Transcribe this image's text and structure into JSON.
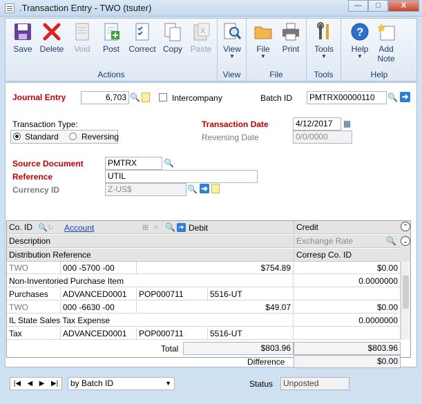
{
  "window": {
    "title": ".Transaction Entry  -  TWO (tsuter)",
    "minimize": "—",
    "restore": "□",
    "close": "X"
  },
  "ribbon": {
    "buttons": {
      "save": "Save",
      "delete": "Delete",
      "void": "Void",
      "post": "Post",
      "correct": "Correct",
      "copy": "Copy",
      "paste": "Paste",
      "view": "View",
      "file": "File",
      "print": "Print",
      "tools": "Tools",
      "help": "Help",
      "add_note_line1": "Add",
      "add_note_line2": "Note"
    },
    "groups": {
      "actions": "Actions",
      "view": "View",
      "file": "File",
      "tools": "Tools",
      "help": "Help"
    }
  },
  "form": {
    "journal_entry_label": "Journal Entry",
    "journal_entry_value": "6,703",
    "intercompany_label": "Intercompany",
    "batch_id_label": "Batch ID",
    "batch_id_value": "PMTRX00000110",
    "transaction_type_label": "Transaction Type:",
    "type_standard": "Standard",
    "type_reversing": "Reversing",
    "transaction_date_label": "Transaction Date",
    "transaction_date_value": "4/12/2017",
    "reversing_date_label": "Reversing Date",
    "reversing_date_value": "0/0/0000",
    "source_document_label": "Source Document",
    "source_document_value": "PMTRX",
    "reference_label": "Reference",
    "reference_value": "UTIL",
    "currency_id_label": "Currency ID",
    "currency_id_value": "Z-US$"
  },
  "grid": {
    "headers": {
      "co_id": "Co. ID",
      "account": "Account",
      "debit": "Debit",
      "credit": "Credit",
      "description": "Description",
      "exchange_rate": "Exchange Rate",
      "distribution_reference": "Distribution Reference",
      "corresp_co_id": "Corresp Co. ID"
    },
    "rows": [
      {
        "co_id": "TWO",
        "account": "000 -5700 -00",
        "debit": "$754.89",
        "credit": "$0.00",
        "description": "Non-Inventoried Purchase Item",
        "exchange_rate": "0.0000000",
        "dist_ref": "Purchases",
        "vendor": "ADVANCED0001",
        "doc": "POP000711",
        "code": "5516-UT"
      },
      {
        "co_id": "TWO",
        "account": "000 -6630 -00",
        "debit": "$49.07",
        "credit": "$0.00",
        "description": "IL State Sales Tax Expense",
        "exchange_rate": "0.0000000",
        "dist_ref": "Tax",
        "vendor": "ADVANCED0001",
        "doc": "POP000711",
        "code": "5516-UT"
      }
    ]
  },
  "totals": {
    "total_label": "Total",
    "total_debit": "$803.96",
    "total_credit": "$803.96",
    "difference_label": "Difference",
    "difference_value": "$0.00"
  },
  "footer": {
    "browse_by": "by Batch ID",
    "status_label": "Status",
    "status_value": "Unposted"
  }
}
